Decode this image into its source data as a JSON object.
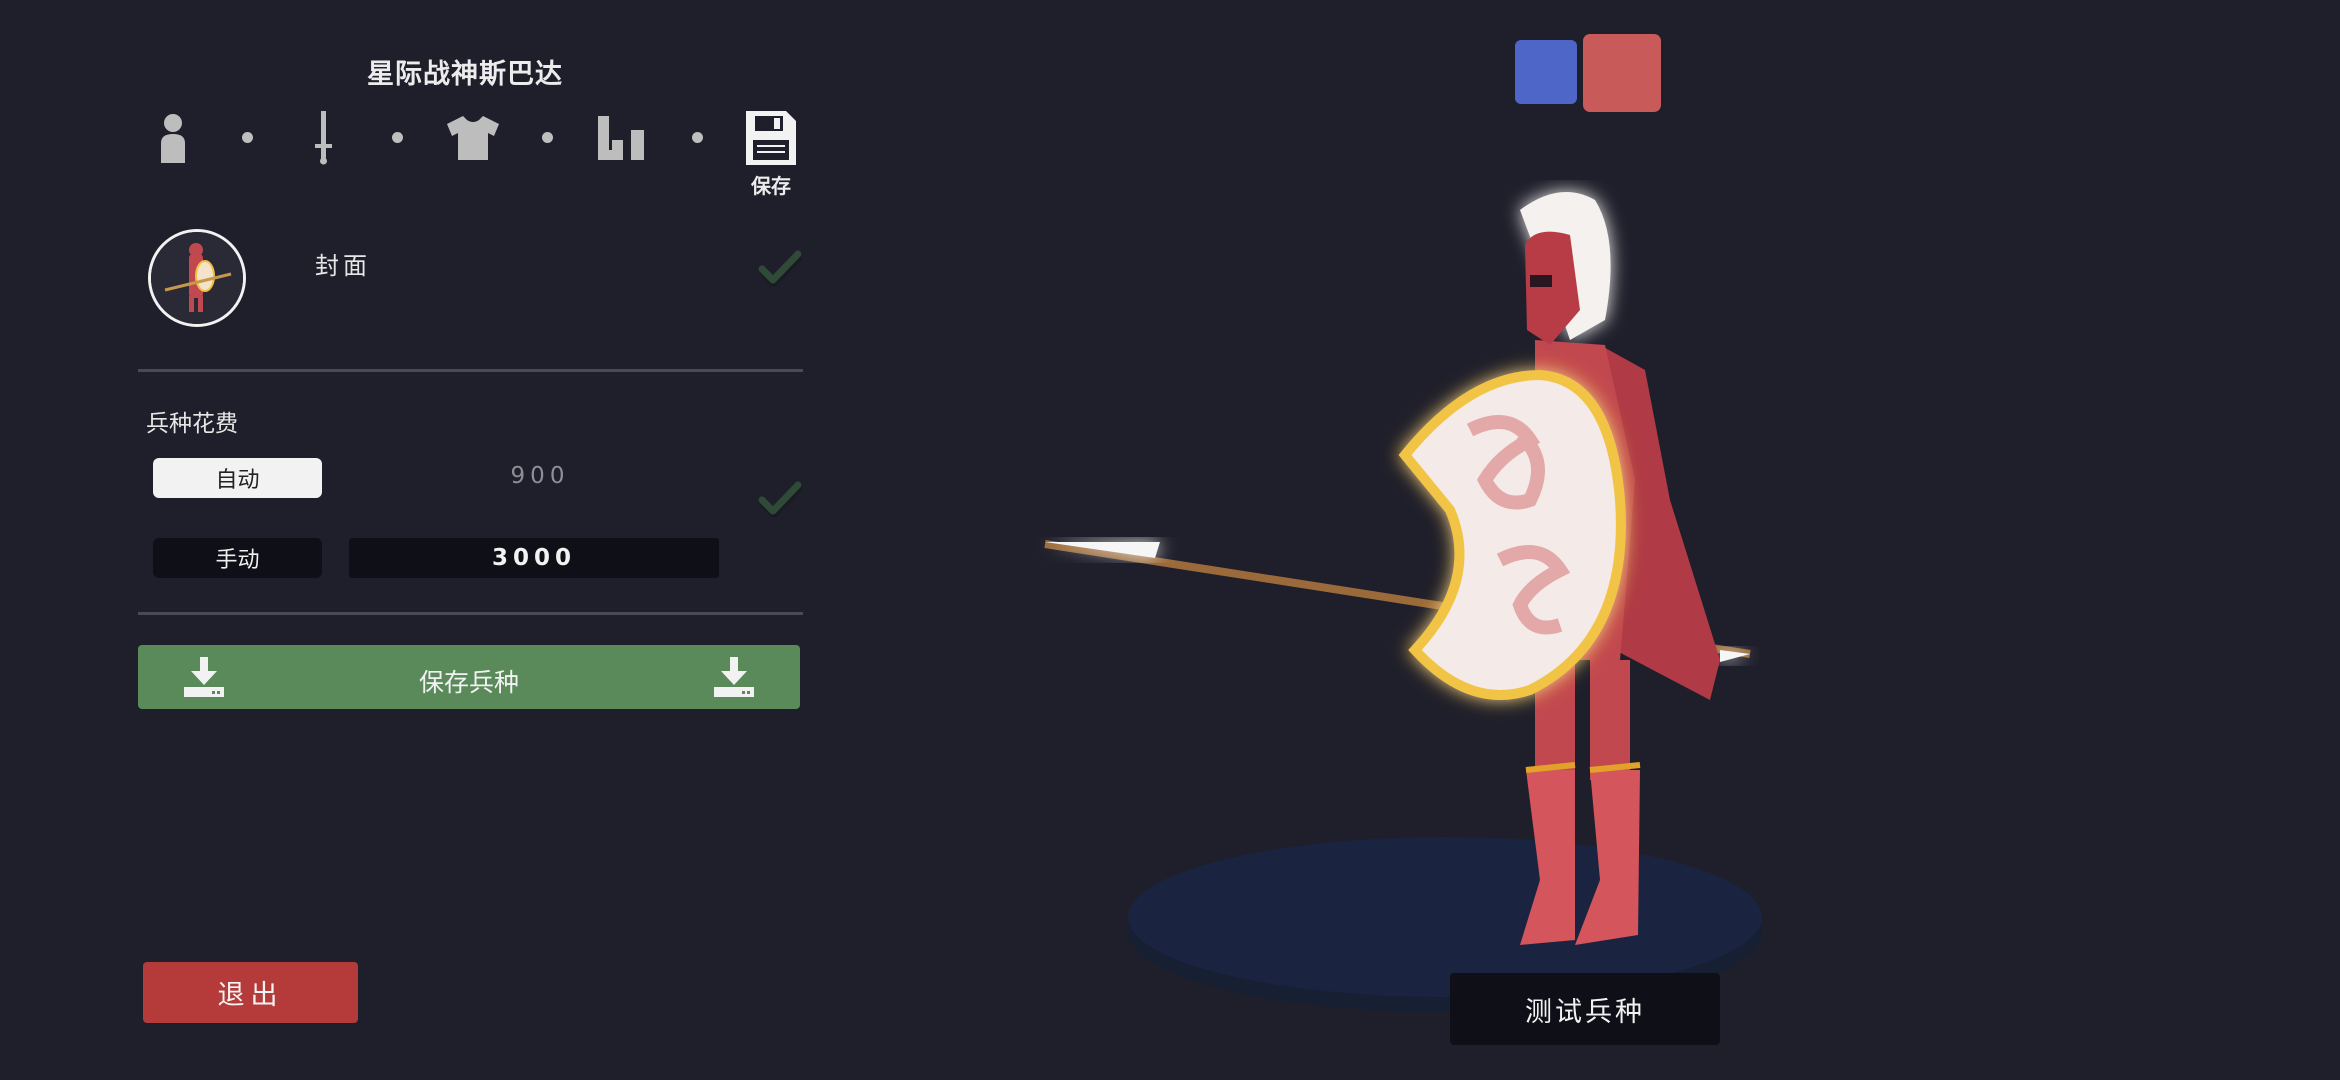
{
  "header": {
    "title": "星际战神斯巴达"
  },
  "steps": [
    {
      "icon": "person-icon"
    },
    {
      "icon": "sword-icon"
    },
    {
      "icon": "shirt-icon"
    },
    {
      "icon": "stats-icon"
    },
    {
      "icon": "save-disk-icon",
      "label": "保存"
    }
  ],
  "cover": {
    "label": "封面",
    "checked": true
  },
  "cost": {
    "title": "兵种花费",
    "auto_label": "自动",
    "auto_value": "900",
    "manual_label": "手动",
    "manual_value": "3000",
    "checked": true
  },
  "actions": {
    "save_unit_label": "保存兵种",
    "exit_label": "退出",
    "test_label": "测试兵种"
  },
  "teams": [
    {
      "color": "#4e66c8"
    },
    {
      "color": "#c95a5a",
      "selected": true
    }
  ],
  "colors": {
    "background": "#1f1f2b",
    "save_green": "#5a8a5a",
    "exit_red": "#b53a3a",
    "check_green": "#2f4a37"
  }
}
